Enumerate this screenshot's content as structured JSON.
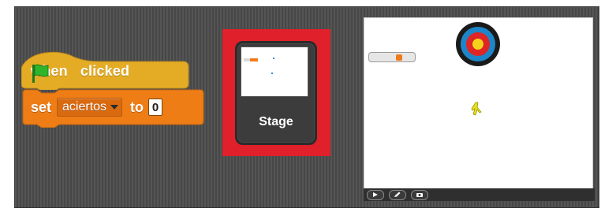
{
  "script": {
    "hat_block": {
      "when_label": "when",
      "flag_icon": "green-flag-icon",
      "clicked_label": "clicked"
    },
    "set_block": {
      "set_label": "set",
      "variable": "aciertos",
      "to_label": "to",
      "value": "0"
    }
  },
  "sprite_tile": {
    "label": "Stage"
  },
  "stage_controls": [
    "presentation-mode-icon",
    "pencil-icon",
    "camera-icon"
  ],
  "colors": {
    "events_block": "#e4ac25",
    "data_block": "#ee7d16",
    "highlight": "#e0202a",
    "flag": "#2fb52a"
  }
}
